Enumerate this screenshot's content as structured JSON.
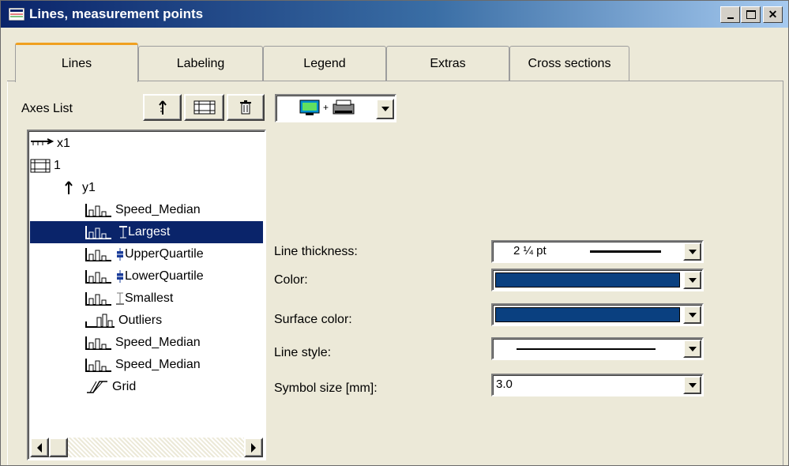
{
  "window": {
    "title": "Lines, measurement points"
  },
  "tabs": [
    {
      "label": "Lines"
    },
    {
      "label": "Labeling"
    },
    {
      "label": "Legend"
    },
    {
      "label": "Extras"
    },
    {
      "label": "Cross sections"
    }
  ],
  "axes_list": {
    "label": "Axes List",
    "tree": [
      {
        "text": "x1",
        "icon": "x-axis-icon"
      },
      {
        "text": "1",
        "icon": "grid-window-icon"
      },
      {
        "text": "y1",
        "icon": "y-axis-icon"
      },
      {
        "text": "Speed_Median",
        "icon": "bar-chart-icon"
      },
      {
        "text": "Largest",
        "icon": "bar-chart-icon",
        "selected": true
      },
      {
        "text": "UpperQuartile",
        "icon": "bar-chart-icon"
      },
      {
        "text": "LowerQuartile",
        "icon": "bar-chart-icon"
      },
      {
        "text": "Smallest",
        "icon": "bar-chart-icon"
      },
      {
        "text": "Outliers",
        "icon": "bar-chart-icon"
      },
      {
        "text": "Speed_Median",
        "icon": "bar-chart-icon"
      },
      {
        "text": "Speed_Median",
        "icon": "bar-chart-icon"
      },
      {
        "text": "Grid",
        "icon": "grid-line-icon"
      }
    ]
  },
  "properties": {
    "line_thickness": {
      "label": "Line thickness:",
      "value": "2 ¼ pt"
    },
    "color": {
      "label": "Color:",
      "value": "#0a4080"
    },
    "surface_color": {
      "label": "Surface color:",
      "value": "#0a4080"
    },
    "line_style": {
      "label": "Line style:"
    },
    "symbol_size": {
      "label": "Symbol size [mm]:",
      "value": "3.0"
    }
  },
  "colors": {
    "title_start": "#0a246a",
    "title_end": "#a6caf0",
    "selection": "#0a246a",
    "accent_tab": "#f0a020"
  }
}
